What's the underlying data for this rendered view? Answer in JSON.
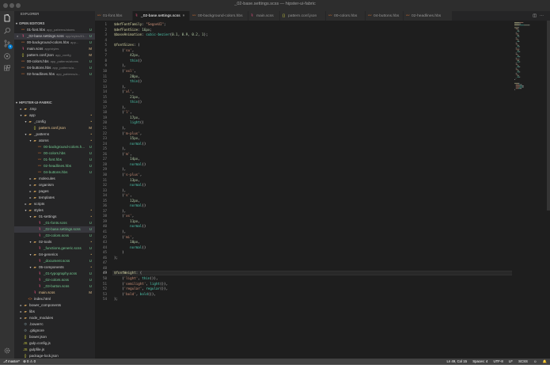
{
  "window": {
    "title": "_02-base.settings.scss — hipster-ui-fabric"
  },
  "activity_bar": {
    "icons": [
      "files-icon",
      "search-icon",
      "source-control-icon",
      "debug-icon",
      "extensions-icon",
      "settings-gear-icon"
    ],
    "scm_badge": "9"
  },
  "sidebar": {
    "title": "EXPLORER",
    "open_editors_header": "OPEN EDITORS",
    "open_editors": [
      {
        "name": "01-font.hbs",
        "desc": "app_patterns/atoms",
        "badge": "U",
        "icon": "hbs"
      },
      {
        "name": "_02-base.settings.scss",
        "desc": "app/styles/01...",
        "badge": "U",
        "icon": "scss",
        "selected": true
      },
      {
        "name": "00-background-colors.hbs",
        "desc": "app...",
        "badge": "U",
        "icon": "hbs"
      },
      {
        "name": "main.scss",
        "desc": "app/styles",
        "badge": "M",
        "icon": "scss"
      },
      {
        "name": "pattern.conf.json",
        "desc": "app_config",
        "badge": "M",
        "icon": "json"
      },
      {
        "name": "00-colors.hbs",
        "desc": "app_patterns/atoms",
        "badge": "U",
        "icon": "hbs"
      },
      {
        "name": "04-buttons.hbs",
        "desc": "app_patterns/a...",
        "badge": "U",
        "icon": "hbs"
      },
      {
        "name": "02-headlines.hbs",
        "desc": "app_patterns/a...",
        "badge": "U",
        "icon": "hbs"
      }
    ],
    "project_header": "HIPSTER-UI-FABRIC",
    "tree": [
      {
        "name": ".tmp",
        "type": "folder",
        "depth": 0,
        "open": false
      },
      {
        "name": "app",
        "type": "folder",
        "depth": 0,
        "open": true,
        "badge": "•"
      },
      {
        "name": "_config",
        "type": "folder",
        "depth": 1,
        "open": true,
        "badge": "•"
      },
      {
        "name": "pattern.conf.json",
        "type": "json",
        "depth": 2,
        "badge": "M"
      },
      {
        "name": "_patterns",
        "type": "folder",
        "depth": 1,
        "open": true,
        "badge": "•"
      },
      {
        "name": "atoms",
        "type": "folder",
        "depth": 2,
        "open": true,
        "badge": "•"
      },
      {
        "name": "00-background-colors.h...",
        "type": "hbs",
        "depth": 3,
        "badge": "U"
      },
      {
        "name": "00-colors.hbs",
        "type": "hbs",
        "depth": 3,
        "badge": "U"
      },
      {
        "name": "01-font.hbs",
        "type": "hbs",
        "depth": 3,
        "badge": "U"
      },
      {
        "name": "02-headlines.hbs",
        "type": "hbs",
        "depth": 3,
        "badge": "U"
      },
      {
        "name": "04-buttons.hbs",
        "type": "hbs",
        "depth": 3,
        "badge": "U"
      },
      {
        "name": "molecules",
        "type": "folder",
        "depth": 2,
        "open": false
      },
      {
        "name": "organism",
        "type": "folder",
        "depth": 2,
        "open": false
      },
      {
        "name": "pages",
        "type": "folder",
        "depth": 2,
        "open": false
      },
      {
        "name": "templates",
        "type": "folder",
        "depth": 2,
        "open": false
      },
      {
        "name": "scripts",
        "type": "folder",
        "depth": 1,
        "open": false
      },
      {
        "name": "styles",
        "type": "folder",
        "depth": 1,
        "open": true,
        "badge": "•"
      },
      {
        "name": "01-settings",
        "type": "folder",
        "depth": 2,
        "open": true,
        "badge": "•"
      },
      {
        "name": "_01-fonts.scss",
        "type": "scss",
        "depth": 3,
        "badge": "U"
      },
      {
        "name": "_02-base.settings.scss",
        "type": "scss",
        "depth": 3,
        "badge": "U",
        "selected": true
      },
      {
        "name": "_03-colors.scss",
        "type": "scss",
        "depth": 3,
        "badge": "U"
      },
      {
        "name": "02-tools",
        "type": "folder",
        "depth": 2,
        "open": true,
        "badge": "•"
      },
      {
        "name": "_functions.generic.scss",
        "type": "scss",
        "depth": 3,
        "badge": "U"
      },
      {
        "name": "04-generics",
        "type": "folder",
        "depth": 2,
        "open": true,
        "badge": "•"
      },
      {
        "name": "_document.scss",
        "type": "scss",
        "depth": 3,
        "badge": "U"
      },
      {
        "name": "05-components",
        "type": "folder",
        "depth": 2,
        "open": true,
        "badge": "•"
      },
      {
        "name": "_01-typography.scss",
        "type": "scss",
        "depth": 3,
        "badge": "U"
      },
      {
        "name": "_02-colors.scss",
        "type": "scss",
        "depth": 3,
        "badge": "U"
      },
      {
        "name": "_03-button.scss",
        "type": "scss",
        "depth": 3,
        "badge": "U"
      },
      {
        "name": "main.scss",
        "type": "scss",
        "depth": 2,
        "badge": "M"
      },
      {
        "name": "index.html",
        "type": "html",
        "depth": 1
      },
      {
        "name": "bower_components",
        "type": "folder",
        "depth": 0,
        "open": false
      },
      {
        "name": "libs",
        "type": "folder",
        "depth": 0,
        "open": false
      },
      {
        "name": "node_modules",
        "type": "folder",
        "depth": 0,
        "open": false
      },
      {
        "name": ".bowerrc",
        "type": "config",
        "depth": 0
      },
      {
        "name": ".gitignore",
        "type": "config",
        "depth": 0
      },
      {
        "name": "bower.json",
        "type": "json",
        "depth": 0
      },
      {
        "name": "gulp.config.js",
        "type": "js",
        "depth": 0
      },
      {
        "name": "gulpfile.js",
        "type": "js",
        "depth": 0
      },
      {
        "name": "package-lock.json",
        "type": "json",
        "depth": 0
      }
    ]
  },
  "tabs": [
    {
      "label": "01-font.hbs",
      "icon": "hbs"
    },
    {
      "label": "_02-base.settings.scss",
      "icon": "scss",
      "active": true,
      "close": "×"
    },
    {
      "label": "00-background-colors.hbs",
      "icon": "hbs"
    },
    {
      "label": "main.scss",
      "icon": "scss"
    },
    {
      "label": "pattern.conf.json",
      "icon": "json"
    },
    {
      "label": "00-colors.hbs",
      "icon": "hbs"
    },
    {
      "label": "04-buttons.hbs",
      "icon": "hbs"
    },
    {
      "label": "02-headlines.hbs",
      "icon": "hbs"
    }
  ],
  "editor": {
    "cursor_line": 49,
    "lines": [
      [
        [
          "v",
          "$defFontFamily"
        ],
        [
          "p",
          ": "
        ],
        [
          "s",
          "\"SegoeUI\""
        ],
        [
          "p",
          ";"
        ]
      ],
      [
        [
          "v",
          "$defFontSize"
        ],
        [
          "p",
          ": "
        ],
        [
          "n",
          "16px"
        ],
        [
          "p",
          ";"
        ]
      ],
      [
        [
          "v",
          "$baseAnimation"
        ],
        [
          "p",
          ": "
        ],
        [
          "f",
          "cubic-bezier"
        ],
        [
          "p",
          "("
        ],
        [
          "n",
          "0.1"
        ],
        [
          "p",
          ", "
        ],
        [
          "n",
          "0.9"
        ],
        [
          "p",
          ", "
        ],
        [
          "n",
          "0.2"
        ],
        [
          "p",
          ", "
        ],
        [
          "n",
          "1"
        ],
        [
          "p",
          ");"
        ]
      ],
      [],
      [
        [
          "v",
          "$fontSizes"
        ],
        [
          "p",
          ": ("
        ]
      ],
      [
        [
          "p",
          "    ("
        ],
        [
          "s",
          "'su'"
        ],
        [
          "p",
          ","
        ]
      ],
      [
        [
          "p",
          "        "
        ],
        [
          "n",
          "42px"
        ],
        [
          "p",
          ","
        ]
      ],
      [
        [
          "p",
          "        "
        ],
        [
          "f",
          "thin"
        ],
        [
          "p",
          "()"
        ]
      ],
      [
        [
          "p",
          "    ),"
        ]
      ],
      [
        [
          "p",
          "    ("
        ],
        [
          "s",
          "'xxl'"
        ],
        [
          "p",
          ","
        ]
      ],
      [
        [
          "p",
          "        "
        ],
        [
          "n",
          "28px"
        ],
        [
          "p",
          ","
        ]
      ],
      [
        [
          "p",
          "        "
        ],
        [
          "f",
          "thin"
        ],
        [
          "p",
          "()"
        ]
      ],
      [
        [
          "p",
          "    ),"
        ]
      ],
      [
        [
          "p",
          "    ("
        ],
        [
          "s",
          "'xl'"
        ],
        [
          "p",
          ","
        ]
      ],
      [
        [
          "p",
          "        "
        ],
        [
          "n",
          "21px"
        ],
        [
          "p",
          ","
        ]
      ],
      [
        [
          "p",
          "        "
        ],
        [
          "f",
          "thin"
        ],
        [
          "p",
          "()"
        ]
      ],
      [
        [
          "p",
          "    ),"
        ]
      ],
      [
        [
          "p",
          "    ("
        ],
        [
          "s",
          "'l'"
        ],
        [
          "p",
          ","
        ]
      ],
      [
        [
          "p",
          "        "
        ],
        [
          "n",
          "17px"
        ],
        [
          "p",
          ","
        ]
      ],
      [
        [
          "p",
          "        "
        ],
        [
          "f",
          "light"
        ],
        [
          "p",
          "()"
        ]
      ],
      [
        [
          "p",
          "    ),"
        ]
      ],
      [
        [
          "p",
          "    ("
        ],
        [
          "s",
          "'m-plus'"
        ],
        [
          "p",
          ","
        ]
      ],
      [
        [
          "p",
          "        "
        ],
        [
          "n",
          "15px"
        ],
        [
          "p",
          ","
        ]
      ],
      [
        [
          "p",
          "        "
        ],
        [
          "f",
          "normal"
        ],
        [
          "p",
          "()"
        ]
      ],
      [
        [
          "p",
          "    ),"
        ]
      ],
      [
        [
          "p",
          "    ("
        ],
        [
          "s",
          "'m'"
        ],
        [
          "p",
          ","
        ]
      ],
      [
        [
          "p",
          "        "
        ],
        [
          "n",
          "14px"
        ],
        [
          "p",
          ","
        ]
      ],
      [
        [
          "p",
          "        "
        ],
        [
          "f",
          "normal"
        ],
        [
          "p",
          "()"
        ]
      ],
      [
        [
          "p",
          "    ),"
        ]
      ],
      [
        [
          "p",
          "    ("
        ],
        [
          "s",
          "'s-plus'"
        ],
        [
          "p",
          ","
        ]
      ],
      [
        [
          "p",
          "        "
        ],
        [
          "n",
          "13px"
        ],
        [
          "p",
          ","
        ]
      ],
      [
        [
          "p",
          "        "
        ],
        [
          "f",
          "normal"
        ],
        [
          "p",
          "()"
        ]
      ],
      [
        [
          "p",
          "    ),"
        ]
      ],
      [
        [
          "p",
          "    ("
        ],
        [
          "s",
          "'s'"
        ],
        [
          "p",
          ","
        ]
      ],
      [
        [
          "p",
          "        "
        ],
        [
          "n",
          "12px"
        ],
        [
          "p",
          ","
        ]
      ],
      [
        [
          "p",
          "        "
        ],
        [
          "f",
          "normal"
        ],
        [
          "p",
          "()"
        ]
      ],
      [
        [
          "p",
          "    ),"
        ]
      ],
      [
        [
          "p",
          "    ("
        ],
        [
          "s",
          "'xs'"
        ],
        [
          "p",
          ","
        ]
      ],
      [
        [
          "p",
          "        "
        ],
        [
          "n",
          "11px"
        ],
        [
          "p",
          ","
        ]
      ],
      [
        [
          "p",
          "        "
        ],
        [
          "f",
          "normal"
        ],
        [
          "p",
          "()"
        ]
      ],
      [
        [
          "p",
          "    ),"
        ]
      ],
      [
        [
          "p",
          "    ("
        ],
        [
          "s",
          "'mi'"
        ],
        [
          "p",
          ","
        ]
      ],
      [
        [
          "p",
          "        "
        ],
        [
          "n",
          "10px"
        ],
        [
          "p",
          ","
        ]
      ],
      [
        [
          "p",
          "        "
        ],
        [
          "f",
          "normal"
        ],
        [
          "p",
          "()"
        ]
      ],
      [
        [
          "p",
          "    )"
        ]
      ],
      [
        [
          "p",
          ");"
        ]
      ],
      [],
      [],
      [
        [
          "v",
          "$fontWeight"
        ],
        [
          "p",
          ": ("
        ]
      ],
      [
        [
          "p",
          "    ("
        ],
        [
          "s",
          "'light'"
        ],
        [
          "p",
          ", "
        ],
        [
          "f",
          "thin"
        ],
        [
          "p",
          "()),"
        ]
      ],
      [
        [
          "p",
          "    ("
        ],
        [
          "s",
          "'semilight'"
        ],
        [
          "p",
          ", "
        ],
        [
          "f",
          "light"
        ],
        [
          "p",
          "()),"
        ]
      ],
      [
        [
          "p",
          "    ("
        ],
        [
          "s",
          "'regular'"
        ],
        [
          "p",
          ", "
        ],
        [
          "f",
          "regular"
        ],
        [
          "p",
          "()),"
        ]
      ],
      [
        [
          "p",
          "    ("
        ],
        [
          "s",
          "'bold'"
        ],
        [
          "p",
          ", "
        ],
        [
          "f",
          "bold"
        ],
        [
          "p",
          "()),"
        ]
      ],
      [
        [
          "p",
          ");"
        ]
      ]
    ]
  },
  "statusbar": {
    "branch": "⎇ master*",
    "problems": "⊗ 0 ⚠ 0",
    "position": "Ln 49, Col 15",
    "indent": "Spaces: 4",
    "encoding": "UTF-8",
    "eol": "LF",
    "language": "SCSS",
    "feedback": "☺",
    "bell": "🔔"
  },
  "colors": {
    "string": "#ce9178",
    "variable": "#dcdcaa",
    "number": "#b5cea8",
    "function": "#4ec9b0",
    "punct": "#d4d4d4",
    "badge_u": "#73c991",
    "badge_m": "#e2c08d",
    "scss_icon": "#f55385",
    "hbs_icon": "#e37933",
    "json_icon": "#cbcb41",
    "html_icon": "#e37933",
    "js_icon": "#cbcb41",
    "config_icon": "#6d8086"
  }
}
